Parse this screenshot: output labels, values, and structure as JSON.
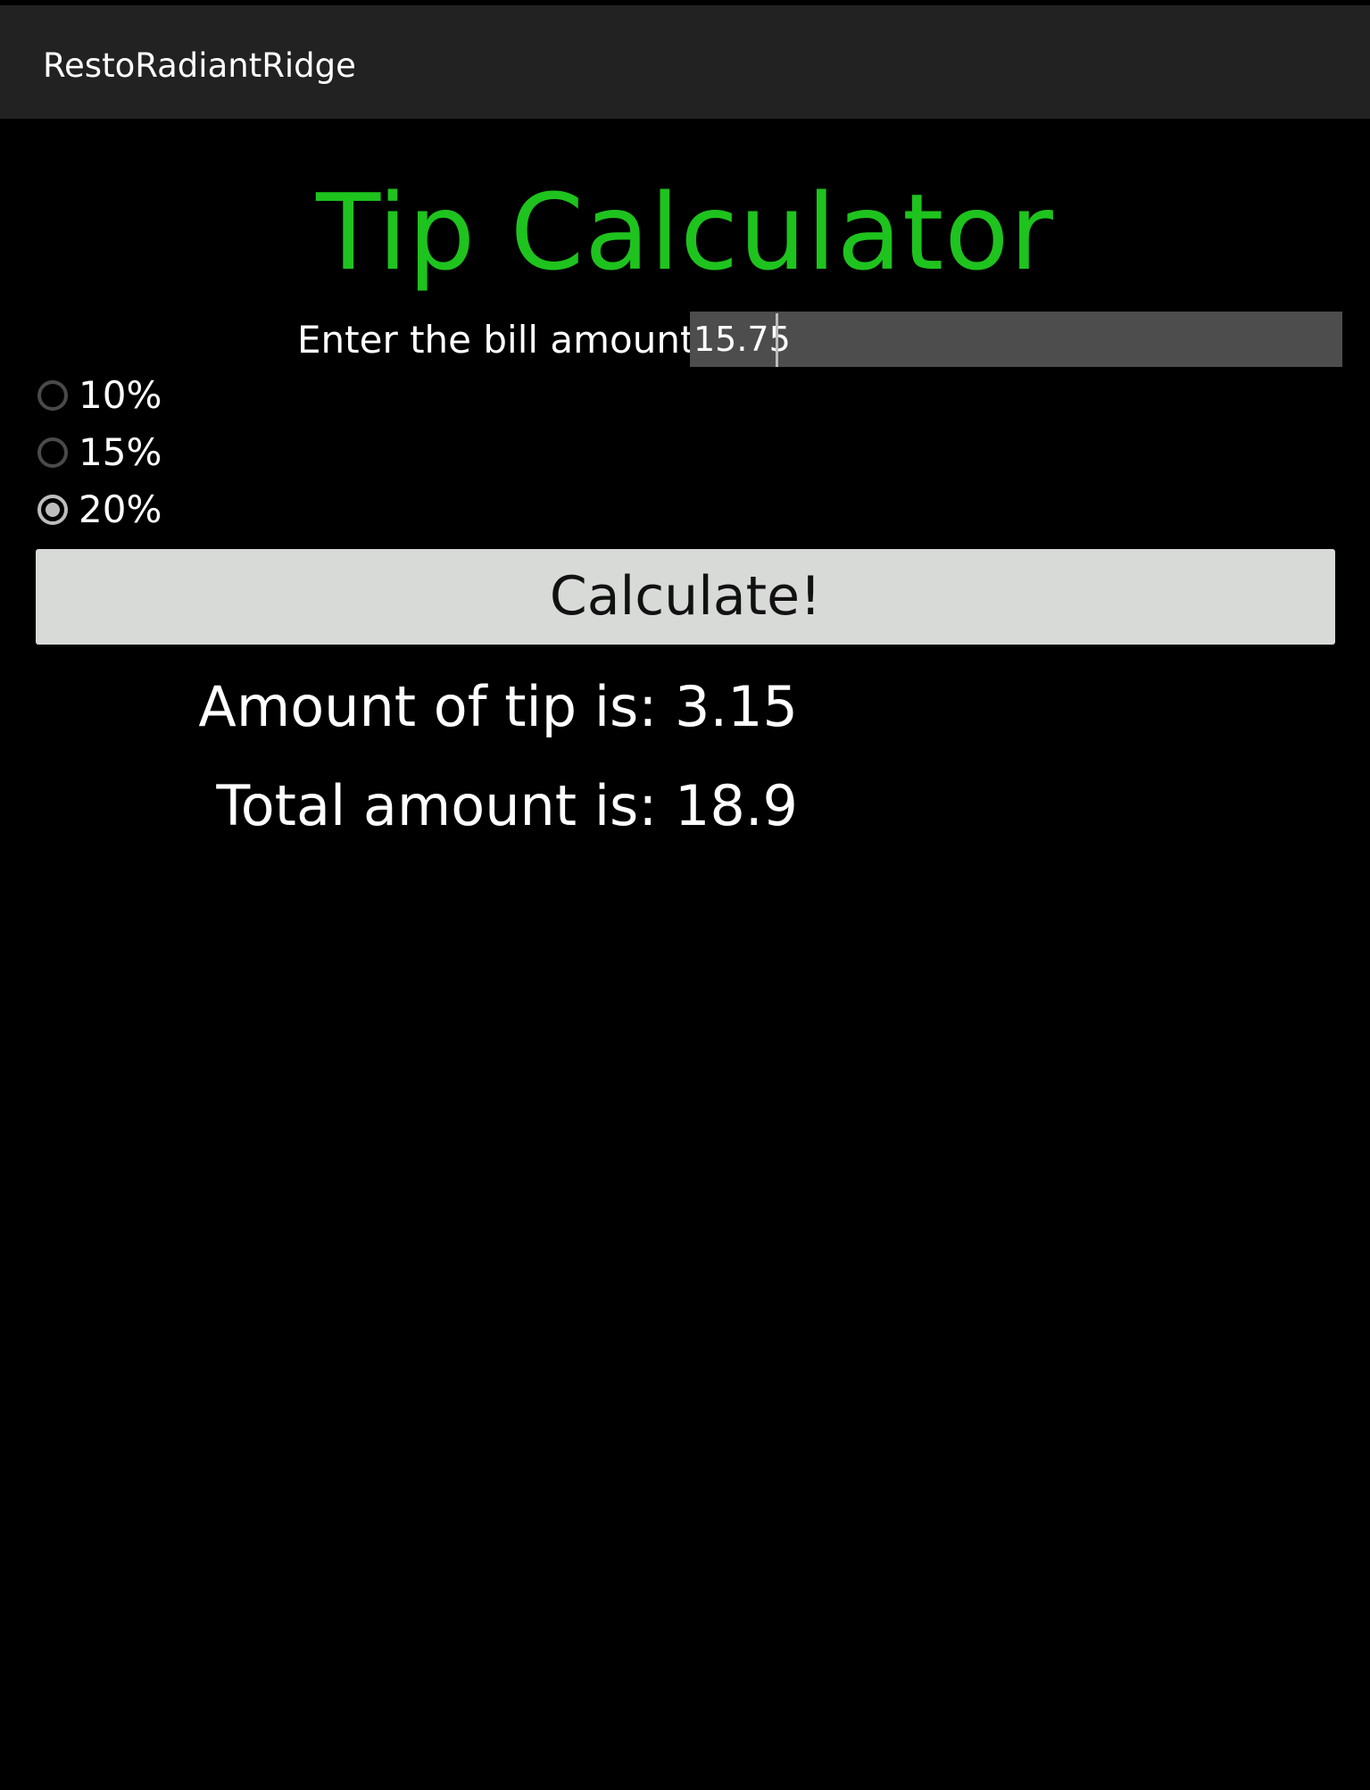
{
  "app": {
    "title": "RestoRadiantRidge"
  },
  "main": {
    "heading": "Tip Calculator",
    "bill_label": "Enter the bill amount:",
    "bill_value": "15.75",
    "tip_options": [
      {
        "label": "10%",
        "selected": false
      },
      {
        "label": "15%",
        "selected": false
      },
      {
        "label": "20%",
        "selected": true
      }
    ],
    "calculate_label": "Calculate!",
    "tip_result": "Amount of tip is: 3.15",
    "total_result": "Total amount is: 18.9"
  },
  "colors": {
    "title_bar": "#222222",
    "background": "#000000",
    "heading": "#1ec31e",
    "input_background": "#4d4d4d",
    "button_background": "#d8dad8"
  }
}
